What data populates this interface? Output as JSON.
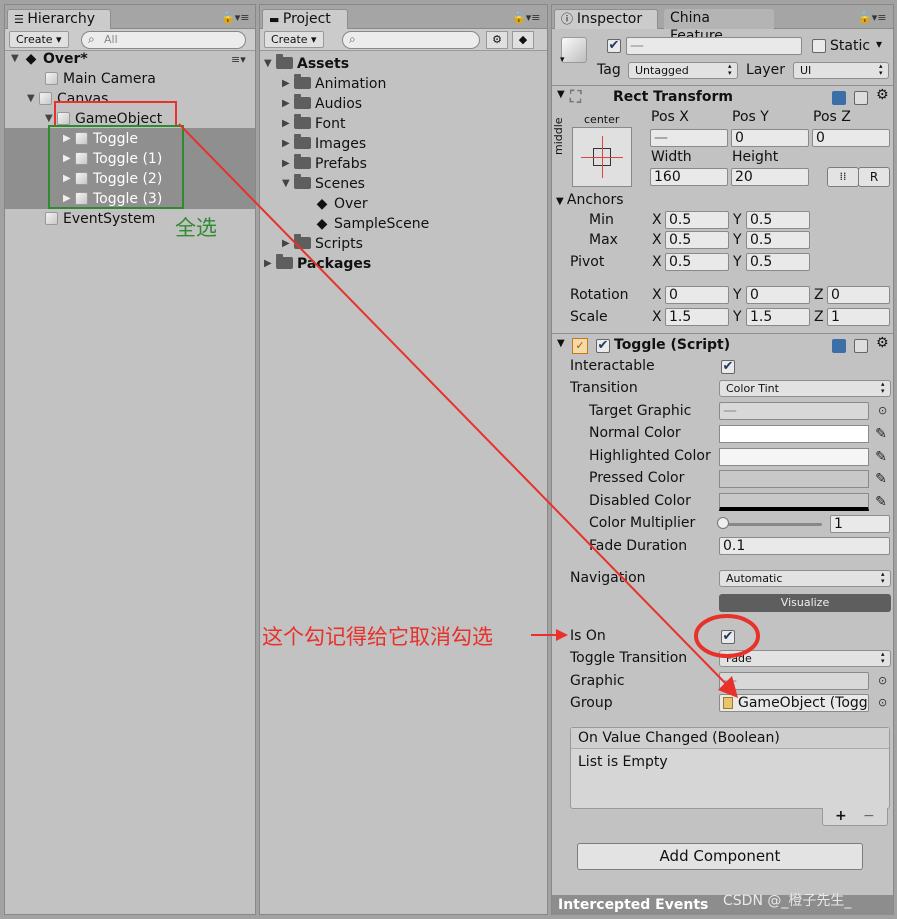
{
  "hierarchy": {
    "tab": "Hierarchy",
    "create": "Create",
    "search_placeholder": "All",
    "scene": "Over*",
    "items": {
      "main_camera": "Main Camera",
      "canvas": "Canvas",
      "gameobject": "GameObject",
      "toggle0": "Toggle",
      "toggle1": "Toggle (1)",
      "toggle2": "Toggle (2)",
      "toggle3": "Toggle (3)",
      "eventsystem": "EventSystem"
    }
  },
  "project": {
    "tab": "Project",
    "create": "Create",
    "assets": "Assets",
    "folders": {
      "animation": "Animation",
      "audios": "Audios",
      "font": "Font",
      "images": "Images",
      "prefabs": "Prefabs",
      "scenes": "Scenes",
      "over": "Over",
      "samplescene": "SampleScene",
      "scripts": "Scripts"
    },
    "packages": "Packages"
  },
  "inspector": {
    "tab": "Inspector",
    "tab2": "China Feature",
    "name_value": "—",
    "static_label": "Static",
    "tag_label": "Tag",
    "tag_value": "Untagged",
    "layer_label": "Layer",
    "layer_value": "UI",
    "rect": {
      "title": "Rect Transform",
      "anchor_h": "center",
      "anchor_v": "middle",
      "posx_label": "Pos X",
      "posy_label": "Pos Y",
      "posz_label": "Pos Z",
      "posx": "—",
      "posy": "0",
      "posz": "0",
      "width_label": "Width",
      "height_label": "Height",
      "width": "160",
      "height": "20",
      "r_btn": "R",
      "anchors_label": "Anchors",
      "min_label": "Min",
      "max_label": "Max",
      "pivot_label": "Pivot",
      "x": "X",
      "y": "Y",
      "z": "Z",
      "min_x": "0.5",
      "min_y": "0.5",
      "max_x": "0.5",
      "max_y": "0.5",
      "pivot_x": "0.5",
      "pivot_y": "0.5",
      "rotation_label": "Rotation",
      "scale_label": "Scale",
      "rot_x": "0",
      "rot_y": "0",
      "rot_z": "0",
      "scale_x": "1.5",
      "scale_y": "1.5",
      "scale_z": "1"
    },
    "toggle": {
      "title": "Toggle (Script)",
      "interactable": "Interactable",
      "transition": "Transition",
      "transition_value": "Color Tint",
      "target_graphic": "Target Graphic",
      "target_graphic_value": "—",
      "normal_color": "Normal Color",
      "highlighted_color": "Highlighted Color",
      "pressed_color": "Pressed Color",
      "disabled_color": "Disabled Color",
      "color_multiplier": "Color Multiplier",
      "color_multiplier_value": "1",
      "fade_duration": "Fade Duration",
      "fade_duration_value": "0.1",
      "navigation": "Navigation",
      "navigation_value": "Automatic",
      "visualize": "Visualize",
      "is_on": "Is On",
      "toggle_transition": "Toggle Transition",
      "toggle_transition_value": "Fade",
      "graphic": "Graphic",
      "graphic_value": "—",
      "group": "Group",
      "group_value": "GameObject (Togg",
      "event_title": "On Value Changed (Boolean)",
      "event_empty": "List is Empty",
      "plus": "+",
      "minus": "−"
    },
    "add_component": "Add Component",
    "intercepted": "Intercepted Events"
  },
  "annotations": {
    "select_all": "全选",
    "uncheck_note": "这个勾记得给它取消勾选",
    "watermark": "CSDN @_橙子先生_"
  },
  "colors": {
    "red": "#e8312a",
    "green": "#2e8b2e",
    "selection": "#8f8f8f"
  }
}
